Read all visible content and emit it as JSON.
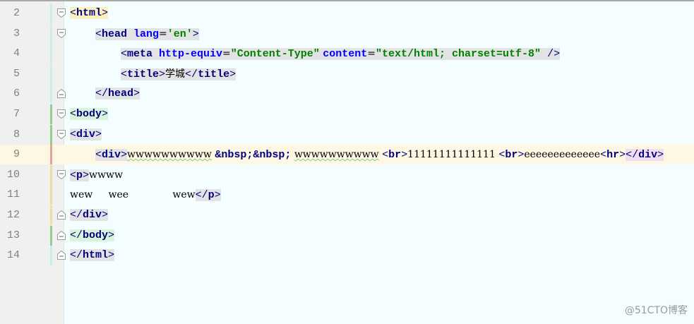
{
  "editor": {
    "language": "html",
    "current_line": 9,
    "lines": [
      {
        "n": "2",
        "segments": [
          [
            "<",
            "br"
          ],
          [
            "html",
            "tg"
          ],
          [
            ">",
            "br"
          ]
        ]
      },
      {
        "n": "3",
        "segments": [
          [
            "<",
            "br"
          ],
          [
            "head ",
            "tg"
          ],
          [
            "lang",
            "at"
          ],
          [
            "=",
            "tx"
          ],
          [
            "'en'",
            "av"
          ],
          [
            ">",
            "br"
          ]
        ]
      },
      {
        "n": "4",
        "segments": [
          [
            "<",
            "br"
          ],
          [
            "meta ",
            "tg"
          ],
          [
            "http-equiv",
            "at"
          ],
          [
            "=",
            "tx"
          ],
          [
            "\"Content-Type\"",
            "av"
          ],
          [
            " ",
            "tx"
          ],
          [
            "content",
            "at"
          ],
          [
            "=",
            "tx"
          ],
          [
            "\"text/html; charset=utf-8\"",
            "av"
          ],
          [
            " />",
            "br"
          ]
        ]
      },
      {
        "n": "5",
        "segments": [
          [
            "<",
            "br"
          ],
          [
            "title",
            "tg"
          ],
          [
            ">",
            "br"
          ],
          [
            "学城",
            "tx"
          ],
          [
            "</",
            "br"
          ],
          [
            "title",
            "tg"
          ],
          [
            ">",
            "br"
          ]
        ]
      },
      {
        "n": "6",
        "segments": [
          [
            "</",
            "br"
          ],
          [
            "head",
            "tg"
          ],
          [
            ">",
            "br"
          ]
        ]
      },
      {
        "n": "7",
        "segments": [
          [
            "<",
            "br"
          ],
          [
            "body",
            "tg"
          ],
          [
            ">",
            "br"
          ]
        ]
      },
      {
        "n": "8",
        "segments": [
          [
            "<",
            "br"
          ],
          [
            "div",
            "tg"
          ],
          [
            ">",
            "br"
          ]
        ]
      },
      {
        "n": "9",
        "segments": [
          [
            "<",
            "br"
          ],
          [
            "div",
            "tg"
          ],
          [
            ">",
            "br"
          ],
          [
            "wwwwwwwwww",
            "tx"
          ],
          [
            " ",
            "tx"
          ],
          [
            "&nbsp;&nbsp;",
            "ent"
          ],
          [
            " ",
            "tx"
          ],
          [
            "wwwwwwwwww",
            "tx"
          ],
          [
            " ",
            "tx"
          ],
          [
            "<",
            "br"
          ],
          [
            "br",
            "tg"
          ],
          [
            ">",
            "br"
          ],
          [
            "11111111111111",
            "tx"
          ],
          [
            " ",
            "tx"
          ],
          [
            "<",
            "br"
          ],
          [
            "br",
            "tg"
          ],
          [
            ">",
            "br"
          ],
          [
            "eeeeeeeeeeeee",
            "tx"
          ],
          [
            "<",
            "br"
          ],
          [
            "hr",
            "tg"
          ],
          [
            ">",
            "br"
          ],
          [
            "</",
            "br"
          ],
          [
            "div",
            "tg"
          ],
          [
            ">",
            "br"
          ]
        ]
      },
      {
        "n": "10",
        "segments": [
          [
            "<",
            "br"
          ],
          [
            "p",
            "tg"
          ],
          [
            ">",
            "br"
          ],
          [
            "wwww",
            "tx"
          ]
        ]
      },
      {
        "n": "11",
        "segments": [
          [
            "wew     wee              wew",
            "tx"
          ],
          [
            "</",
            "br"
          ],
          [
            "p",
            "tg"
          ],
          [
            ">",
            "br"
          ]
        ]
      },
      {
        "n": "12",
        "segments": [
          [
            "</",
            "br"
          ],
          [
            "div",
            "tg"
          ],
          [
            ">",
            "br"
          ]
        ]
      },
      {
        "n": "13",
        "segments": [
          [
            "</",
            "br"
          ],
          [
            "body",
            "tg"
          ],
          [
            ">",
            "br"
          ]
        ]
      },
      {
        "n": "14",
        "segments": [
          [
            "</",
            "br"
          ],
          [
            "html",
            "tg"
          ],
          [
            ">",
            "br"
          ]
        ]
      }
    ]
  },
  "watermark": "@51CTO博客",
  "colors": {
    "background": "#f4fdff",
    "gutter": "#f0f0f0",
    "tag": "#000080",
    "attribute": "#0000ff",
    "attribute_value": "#008000",
    "current_line": "#fdf7e4"
  },
  "icons": {
    "fold_open": "fold-expanded-icon",
    "fold_close": "fold-end-icon"
  }
}
